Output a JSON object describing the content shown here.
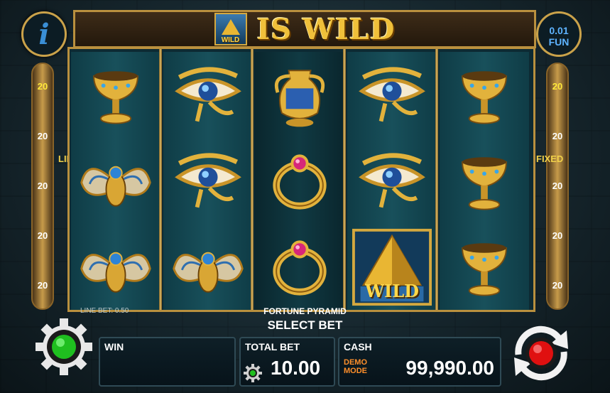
{
  "header": {
    "info_label": "i",
    "banner_title": "IS WILD",
    "banner_icon_label": "WILD",
    "denomination": "0.01",
    "currency": "FUN"
  },
  "lines_panel": {
    "left_label": "LINES",
    "right_label": "FIXED",
    "left_numbers": [
      "20",
      "20",
      "20",
      "20",
      "20"
    ],
    "right_numbers": [
      "20",
      "20",
      "20",
      "20",
      "20"
    ]
  },
  "reels": [
    [
      "golden-chalice",
      "scarab",
      "scarab"
    ],
    [
      "eye-of-horus",
      "eye-of-horus",
      "scarab"
    ],
    [
      "golden-vase",
      "ruby-ring",
      "ruby-ring"
    ],
    [
      "eye-of-horus",
      "eye-of-horus",
      "pyramid-wild"
    ],
    [
      "golden-chalice",
      "golden-chalice",
      "golden-chalice"
    ]
  ],
  "symbols": {
    "wild_label": "WILD"
  },
  "captions": {
    "line_bet": "LINE BET: 0.50",
    "game_name": "FORTUNE PYRAMID",
    "select_bet": "SELECT BET"
  },
  "bottom_bar": {
    "win_label": "WIN",
    "win_value": "",
    "total_bet_label": "TOTAL BET",
    "total_bet_value": "10.00",
    "cash_label": "CASH",
    "demo_line1": "DEMO",
    "demo_line2": "MODE",
    "cash_value": "99,990.00"
  },
  "colors": {
    "gold": "#d4a83f",
    "panel_bg": "#0e1f27",
    "settings_green": "#1fbf1f",
    "spin_red": "#e01010",
    "accent_blue": "#5eb3ff"
  }
}
